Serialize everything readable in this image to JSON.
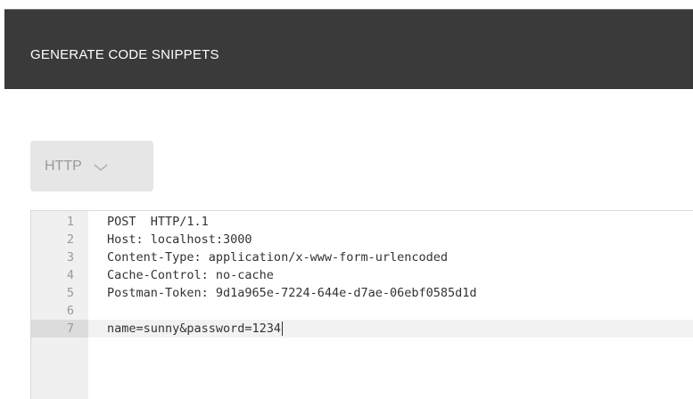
{
  "modal": {
    "title": "GENERATE CODE SNIPPETS"
  },
  "language_selector": {
    "selected": "HTTP",
    "icon": "chevron-down-icon"
  },
  "code": {
    "lines": [
      {
        "number": "1",
        "text": "POST  HTTP/1.1"
      },
      {
        "number": "2",
        "text": "Host: localhost:3000"
      },
      {
        "number": "3",
        "text": "Content-Type: application/x-www-form-urlencoded"
      },
      {
        "number": "4",
        "text": "Cache-Control: no-cache"
      },
      {
        "number": "5",
        "text": "Postman-Token: 9d1a965e-7224-644e-d7ae-06ebf0585d1d"
      },
      {
        "number": "6",
        "text": ""
      },
      {
        "number": "7",
        "text": "name=sunny&password=1234"
      }
    ],
    "active_line": 7
  },
  "colors": {
    "header_bg": "#3a3a3a",
    "dropdown_bg": "#e6e6e6",
    "gutter_bg": "#f0f0f0"
  }
}
